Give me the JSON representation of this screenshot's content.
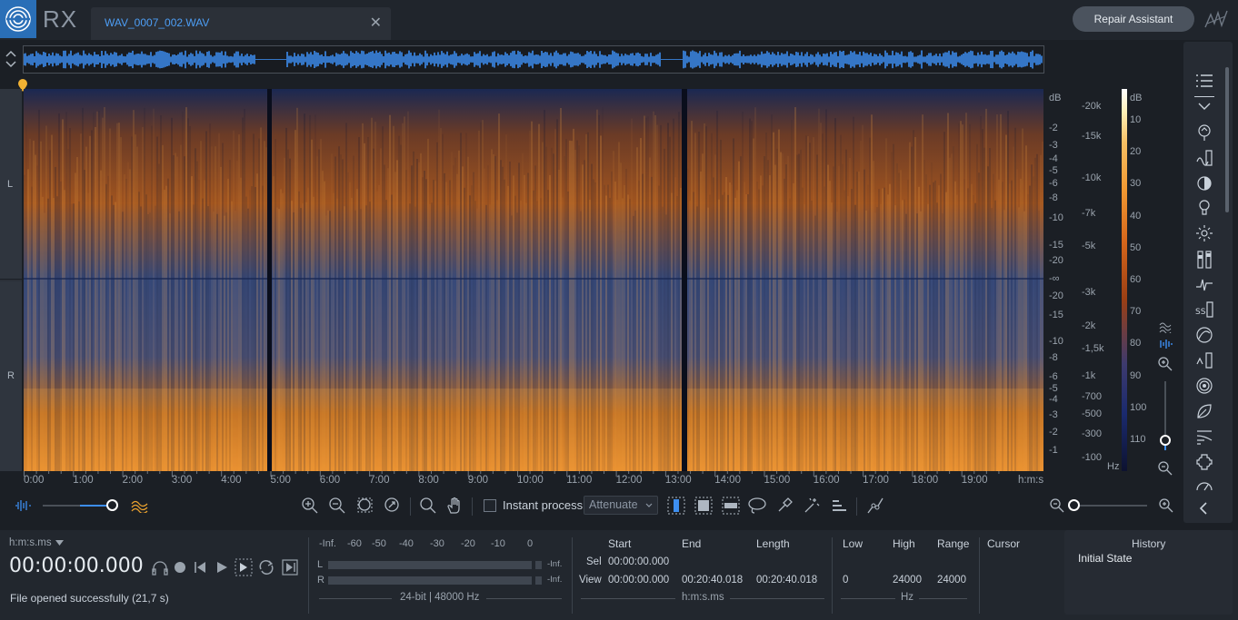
{
  "app": {
    "name": "RX"
  },
  "tab": {
    "file_name": "WAV_0007_002.WAV",
    "close_glyph": "✕"
  },
  "header": {
    "repair_assistant": "Repair Assistant"
  },
  "channels": {
    "left": "L",
    "right": "R"
  },
  "amp_scale": {
    "unit": "dB",
    "labels": [
      "-2",
      "-3",
      "-4",
      "-5",
      "-6",
      "-8",
      "-10",
      "-15",
      "-20",
      "-∞",
      "-20",
      "-15",
      "-10",
      "-8",
      "-6",
      "-5",
      "-4",
      "-3",
      "-2",
      "-1"
    ],
    "first_label": "-1"
  },
  "freq_scale": {
    "labels": [
      "-20k",
      "-15k",
      "-10k",
      "-7k",
      "-5k",
      "-3k",
      "-2k",
      "-1,5k",
      "-1k",
      "-700",
      "-500",
      "-300",
      "-100"
    ],
    "unit": "Hz"
  },
  "color_scale": {
    "unit": "dB",
    "labels": [
      "10",
      "20",
      "30",
      "40",
      "50",
      "60",
      "70",
      "80",
      "90",
      "100",
      "110"
    ]
  },
  "timeline": {
    "labels": [
      "0:00",
      "1:00",
      "2:00",
      "3:00",
      "4:00",
      "5:00",
      "6:00",
      "7:00",
      "8:00",
      "9:00",
      "10:00",
      "11:00",
      "12:00",
      "13:00",
      "14:00",
      "15:00",
      "16:00",
      "17:00",
      "18:00",
      "19:00"
    ],
    "unit": "h:m:s"
  },
  "toolbar": {
    "instant_process": "Instant process",
    "attenuate": "Attenuate"
  },
  "transport": {
    "time_format": "h:m:s.ms",
    "time": "00:00:00.000",
    "status": "File opened successfully (21,7 s)"
  },
  "meter": {
    "scale": [
      "-Inf.",
      "-60",
      "-50",
      "-40",
      "-30",
      "-20",
      "-10",
      "0"
    ],
    "left_label": "L",
    "right_label": "R",
    "left_value": "-Inf.",
    "right_value": "-Inf.",
    "format": "24-bit | 48000 Hz"
  },
  "selection": {
    "start_hdr": "Start",
    "end_hdr": "End",
    "length_hdr": "Length",
    "sel_label": "Sel",
    "view_label": "View",
    "sel_start": "00:00:00.000",
    "view_start": "00:00:00.000",
    "view_end": "00:20:40.018",
    "view_length": "00:20:40.018",
    "unit": "h:m:s.ms"
  },
  "frequency": {
    "low_hdr": "Low",
    "high_hdr": "High",
    "range_hdr": "Range",
    "low": "0",
    "high": "24000",
    "range": "24000",
    "unit": "Hz"
  },
  "cursor": {
    "label": "Cursor"
  },
  "history": {
    "title": "History",
    "items": [
      "Initial State"
    ]
  },
  "colors": {
    "accent": "#2a6fb7",
    "waveform": "#3d8ef0",
    "spectrum_hot": "#f29a33",
    "spectrum_cool": "#2a4d8f"
  }
}
